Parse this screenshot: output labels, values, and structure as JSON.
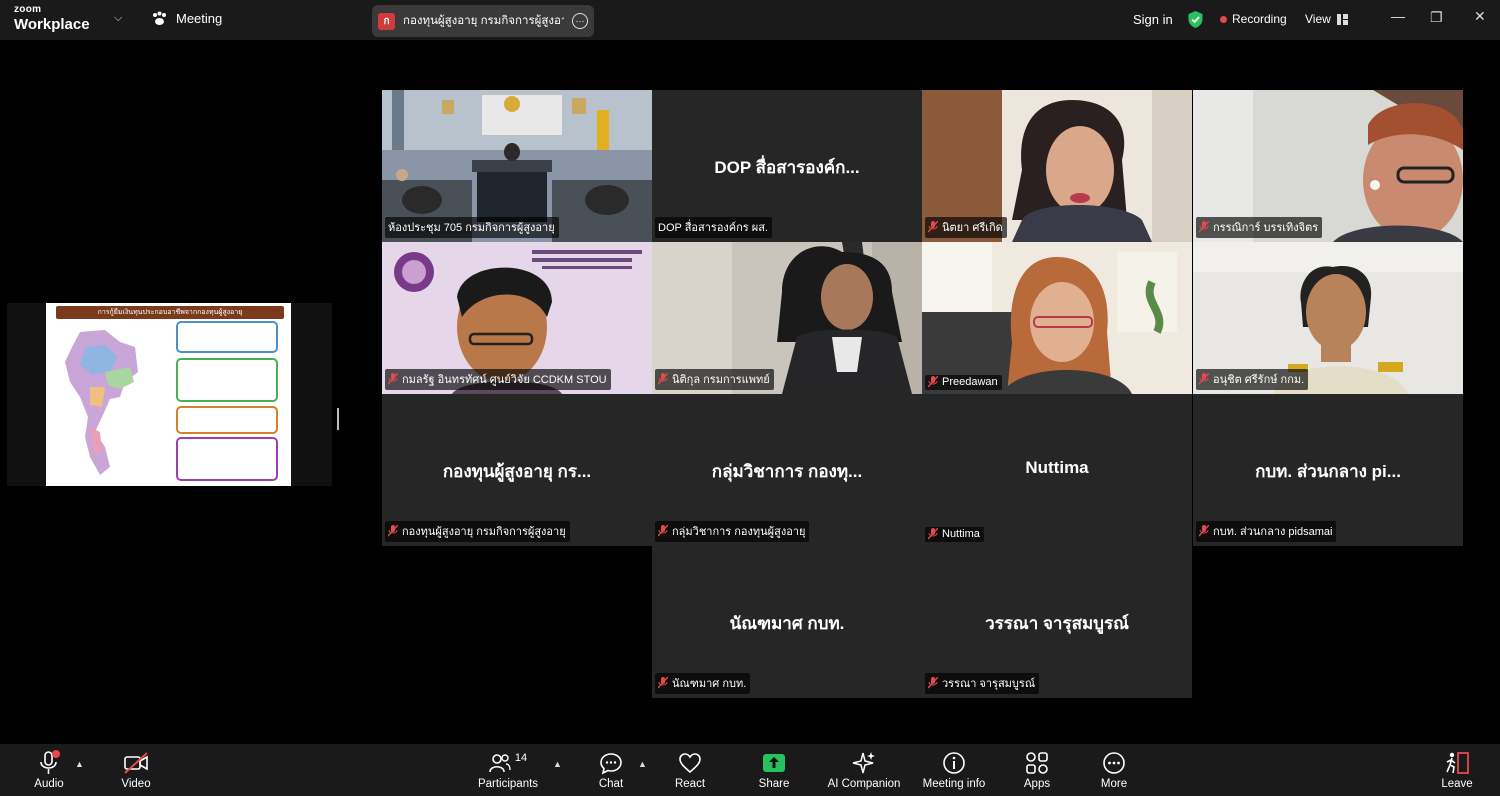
{
  "topbar": {
    "logo_line1": "zoom",
    "logo_line2": "Workplace",
    "meeting_label": "Meeting",
    "tab_initial": "ก",
    "tab_title": "กองทุนผู้สูงอายุ กรมกิจการผู้สูงอายุ's sc",
    "sign_in": "Sign in",
    "recording": "Recording",
    "view": "View"
  },
  "shared_screen": {
    "slide_title": "การกู้ยืมเงินทุนประกอบอาชีพจากกองทุนผู้สูงอายุ"
  },
  "tiles": [
    {
      "label": "ห้องประชุม 705 กรมกิจการผู้สูงอายุ",
      "center": "",
      "muted": false,
      "active": true
    },
    {
      "label": "DOP สื่อสารองค์กร ผส.",
      "center": "DOP สื่อสารองค์ก...",
      "muted": false
    },
    {
      "label": "นิตยา ศรีเกิด",
      "center": "",
      "muted": true
    },
    {
      "label": "กรรณิการ์ บรรเทิงจิตร",
      "center": "",
      "muted": true
    },
    {
      "label": "กมลรัฐ อินทรทัศน์ ศูนย์วิจัย CCDKM STOU",
      "center": "",
      "muted": true
    },
    {
      "label": "นิติกุล กรมการแพทย์",
      "center": "",
      "muted": true
    },
    {
      "label": "Preedawan",
      "center": "",
      "muted": true
    },
    {
      "label": "อนุชิต ศรีรักษ์ กกม.",
      "center": "",
      "muted": true
    },
    {
      "label": "กองทุนผู้สูงอายุ กรมกิจการผู้สูงอายุ",
      "center": "กองทุนผู้สูงอายุ กร...",
      "muted": true
    },
    {
      "label": "กลุ่มวิชาการ กองทุนผู้สูงอายุ",
      "center": "กลุ่มวิชาการ กองทุ...",
      "muted": true
    },
    {
      "label": "Nuttima",
      "center": "Nuttima",
      "muted": true
    },
    {
      "label": "กบท. ส่วนกลาง pidsamai",
      "center": "กบท. ส่วนกลาง pi...",
      "muted": true
    },
    {
      "label": "นัณฑมาศ กบท.",
      "center": "นัณฑมาศ กบท.",
      "muted": true
    },
    {
      "label": "วรรณา  จารุสมบูรณ์",
      "center": "วรรณา  จารุสมบูรณ์",
      "muted": true
    }
  ],
  "toolbar": {
    "audio": "Audio",
    "video": "Video",
    "participants": "Participants",
    "participants_count": "14",
    "chat": "Chat",
    "react": "React",
    "share": "Share",
    "ai_companion": "AI Companion",
    "meeting_info": "Meeting info",
    "apps": "Apps",
    "more": "More",
    "leave": "Leave"
  },
  "colors": {
    "active_speaker": "#3cc46b",
    "share_green": "#27c15e",
    "muted_red": "#e5484d"
  }
}
